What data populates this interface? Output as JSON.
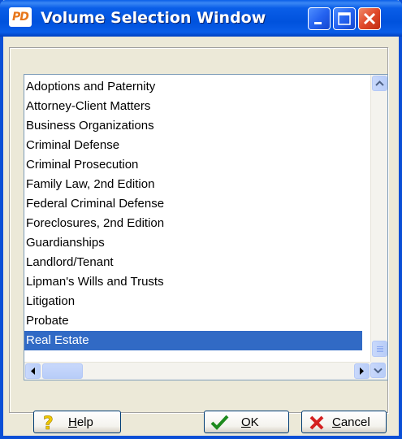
{
  "window": {
    "title": "Volume Selection Window",
    "app_icon_text": "PD"
  },
  "volumes": {
    "items": [
      {
        "label": "Adoptions and Paternity",
        "selected": false
      },
      {
        "label": "Attorney-Client Matters",
        "selected": false
      },
      {
        "label": "Business Organizations",
        "selected": false
      },
      {
        "label": "Criminal Defense",
        "selected": false
      },
      {
        "label": "Criminal Prosecution",
        "selected": false
      },
      {
        "label": "Family Law, 2nd Edition",
        "selected": false
      },
      {
        "label": "Federal Criminal Defense",
        "selected": false
      },
      {
        "label": "Foreclosures, 2nd Edition",
        "selected": false
      },
      {
        "label": "Guardianships",
        "selected": false
      },
      {
        "label": "Landlord/Tenant",
        "selected": false
      },
      {
        "label": "Lipman's Wills and Trusts",
        "selected": false
      },
      {
        "label": "Litigation",
        "selected": false
      },
      {
        "label": "Probate",
        "selected": false
      },
      {
        "label": "Real Estate",
        "selected": true
      }
    ],
    "selected_value": "Real Estate"
  },
  "buttons": {
    "help": "Help",
    "ok": "OK",
    "cancel": "Cancel"
  },
  "icons": {
    "help": "question-mark-icon",
    "ok": "checkmark-icon",
    "cancel": "x-cross-icon"
  },
  "colors": {
    "selection": "#316ac5",
    "titlebar": "#0a5ee8",
    "close_button": "#e0492a",
    "ok_check": "#1e8a1e",
    "cancel_x": "#d42020",
    "help_question": "#f0c800"
  }
}
